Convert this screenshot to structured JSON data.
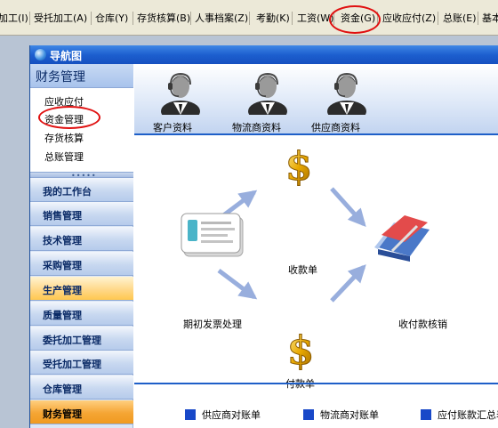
{
  "menubar": {
    "items": [
      {
        "label": "加工(I)"
      },
      {
        "label": "受托加工(A)"
      },
      {
        "label": "仓库(Y)"
      },
      {
        "label": "存货核算(B)"
      },
      {
        "label": "人事档案(Z)"
      },
      {
        "label": "考勤(K)"
      },
      {
        "label": "工资(W)"
      },
      {
        "label": "资金(G)"
      },
      {
        "label": "应收应付(Z)"
      },
      {
        "label": "总账(E)"
      },
      {
        "label": "基本"
      }
    ],
    "highlighted": "资金(G)"
  },
  "window": {
    "title": "导航图"
  },
  "nav": {
    "header": "财务管理",
    "sub_items": [
      "应收应付",
      "资金管理",
      "存货核算",
      "总账管理"
    ],
    "selected_sub": "资金管理",
    "splitter_dots": "•••••",
    "modules": [
      {
        "label": "我的工作台",
        "state": "normal"
      },
      {
        "label": "销售管理",
        "state": "normal"
      },
      {
        "label": "技术管理",
        "state": "normal"
      },
      {
        "label": "采购管理",
        "state": "normal"
      },
      {
        "label": "生产管理",
        "state": "highlight"
      },
      {
        "label": "质量管理",
        "state": "normal"
      },
      {
        "label": "委托加工管理",
        "state": "normal"
      },
      {
        "label": "受托加工管理",
        "state": "normal"
      },
      {
        "label": "仓库管理",
        "state": "normal"
      },
      {
        "label": "财务管理",
        "state": "active"
      }
    ]
  },
  "content": {
    "top_icons": [
      {
        "label": "客户资料",
        "icon": "person-icon"
      },
      {
        "label": "物流商资料",
        "icon": "person-icon"
      },
      {
        "label": "供应商资料",
        "icon": "person-icon"
      }
    ],
    "flow": {
      "invoice": "期初发票处理",
      "receipt": "收款单",
      "payment": "付款单",
      "writeoff": "收付款核销"
    },
    "reports": [
      "供应商对账单",
      "物流商对账单",
      "应付账款汇总表"
    ]
  },
  "colors": {
    "accent": "#1e5fc8",
    "title_bar": "#1d5fcf",
    "highlight_circle": "#e01010",
    "module_active": "#f5a534",
    "dollar_gold": "#e8a800"
  }
}
